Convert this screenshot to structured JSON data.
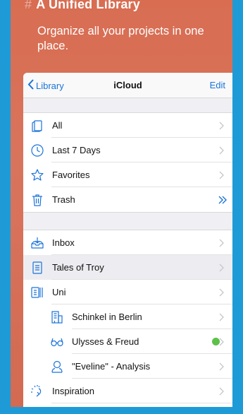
{
  "hero": {
    "hash": "#",
    "title": "A Unified Library",
    "subtitle": "Organize all your projects in one place."
  },
  "navbar": {
    "back_label": "Library",
    "title": "iCloud",
    "edit_label": "Edit"
  },
  "section1": [
    {
      "label": "All",
      "icon": "sheets-icon"
    },
    {
      "label": "Last 7 Days",
      "icon": "clock-icon"
    },
    {
      "label": "Favorites",
      "icon": "star-icon"
    },
    {
      "label": "Trash",
      "icon": "trash-icon"
    }
  ],
  "section2": [
    {
      "label": "Inbox",
      "icon": "inbox-icon"
    },
    {
      "label": "Tales of Troy",
      "icon": "document-icon"
    },
    {
      "label": "Uni",
      "icon": "group-icon"
    },
    {
      "label": "Schinkel in Berlin",
      "icon": "building-icon"
    },
    {
      "label": "Ulysses & Freud",
      "icon": "glasses-icon"
    },
    {
      "label": "\"Eveline\" - Analysis",
      "icon": "person-icon"
    },
    {
      "label": "Inspiration",
      "icon": "lightbulb-icon"
    }
  ],
  "colors": {
    "accent": "#1a73d9",
    "frame_bg": "#1e9bd7",
    "hero_bg": "#d86d52",
    "status_green": "#5cc14a"
  }
}
